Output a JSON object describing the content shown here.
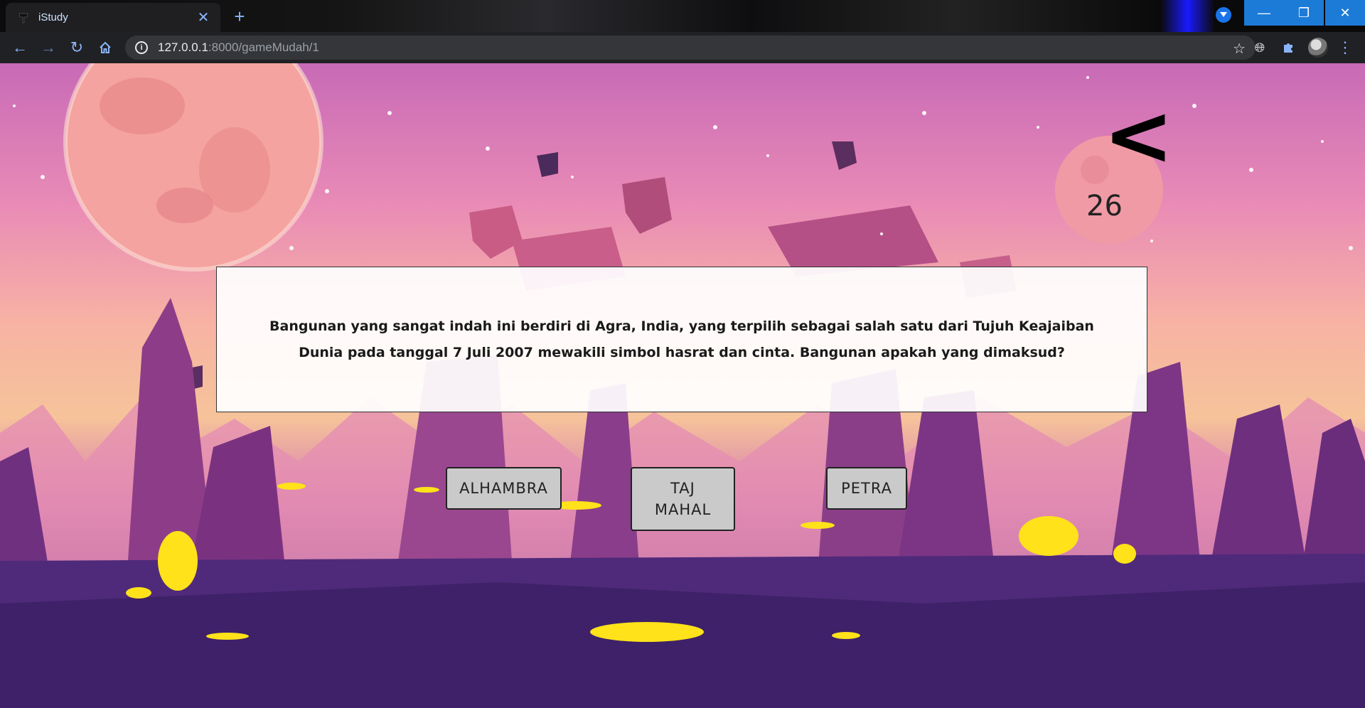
{
  "browser": {
    "tab_title": "iStudy",
    "tab_close_icon": "close-icon",
    "new_tab_icon": "plus-icon",
    "url_host": "127.0.0.1",
    "url_rest": ":8000/gameMudah/1"
  },
  "game": {
    "back_label": "<",
    "timer": "26",
    "question": "Bangunan yang sangat indah ini berdiri di Agra, India, yang terpilih sebagai salah satu dari Tujuh Keajaiban Dunia pada tanggal 7 Juli 2007 mewakili simbol hasrat dan cinta. Bangunan apakah yang dimaksud?",
    "answers": [
      "ALHAMBRA",
      "TAJ MAHAL",
      "PETRA"
    ]
  },
  "colors": {
    "accent": "#1d7bd8",
    "sky_top": "#c86ab6",
    "sky_mid": "#f6c39a",
    "ground": "#4a2a78",
    "lava": "#ffe21a"
  }
}
